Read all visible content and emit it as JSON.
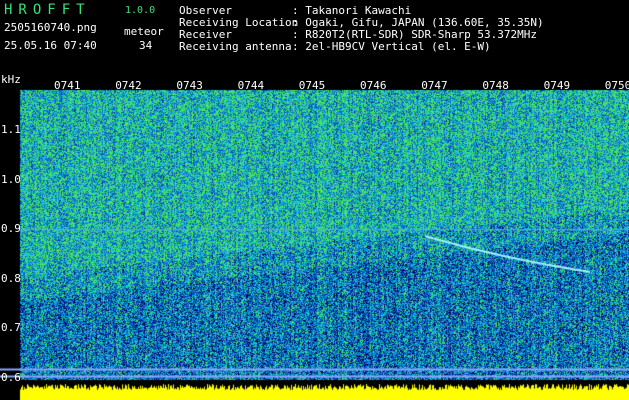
{
  "header": {
    "logo": "HROFFT",
    "version": "1.0.0",
    "filename": "2505160740.png",
    "datetime": "25.05.16 07:40",
    "meteor_label": "meteor",
    "meteor_count": "34",
    "fields": [
      {
        "label": "Observer",
        "value": ": Takanori Kawachi"
      },
      {
        "label": "Receiving Location",
        "value": ": Ogaki, Gifu, JAPAN (136.60E, 35.35N)"
      },
      {
        "label": "Receiver",
        "value": ": R820T2(RTL-SDR) SDR-Sharp 53.372MHz"
      },
      {
        "label": "Receiving antenna",
        "value": ": 2el-HB9CV Vertical (el. E-W)"
      }
    ]
  },
  "spectrogram": {
    "y_unit": "kHz",
    "y_ticks": [
      "1.1",
      "1.0",
      "0.9",
      "0.8",
      "0.7",
      "0.6"
    ],
    "y_tick_values": [
      1.1,
      1.0,
      0.9,
      0.8,
      0.7,
      0.6
    ],
    "x_ticks": [
      "0741",
      "0742",
      "0743",
      "0744",
      "0745",
      "0746",
      "0747",
      "0748",
      "0749",
      "0750"
    ],
    "carrier_khz": 0.9,
    "colors": {
      "background": "#000000",
      "noise_low": "#0a1a8a",
      "noise_mid": "#1a6ad8",
      "signal": "#39e07a",
      "peak": "#ffff00",
      "amplitude_bar": "#ffff00"
    }
  }
}
